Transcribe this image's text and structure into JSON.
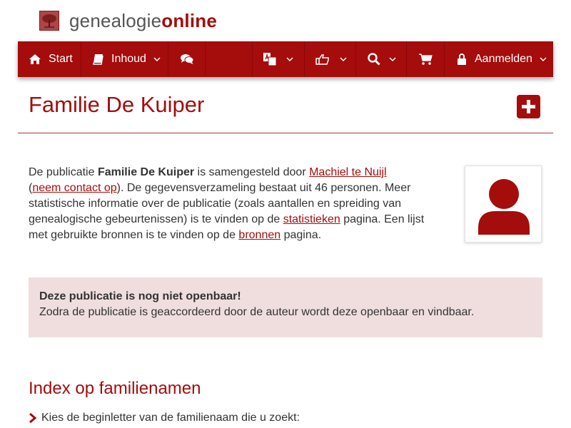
{
  "brand": {
    "part1": "genealogie",
    "part2": "online"
  },
  "nav": {
    "start": "Start",
    "inhoud": "Inhoud",
    "login": "Aanmelden"
  },
  "page": {
    "title": "Familie De Kuiper"
  },
  "intro": {
    "t1": "De publicatie ",
    "pub": "Familie De Kuiper",
    "t2": " is samengesteld door ",
    "author": "Machiel te Nuijl",
    "t3": "(",
    "contact": "neem contact op",
    "t4": "). De gegevensverzameling bestaat uit 46 personen. Meer statistische informatie over de publicatie (zoals aantallen en spreiding van genealogische gebeurtenissen) is te vinden op de ",
    "stats": "statistieken",
    "t5": " pagina. Een lijst met gebruikte bronnen is te vinden op de ",
    "sources": "bronnen",
    "t6": " pagina."
  },
  "alert": {
    "heading": "Deze publicatie is nog niet openbaar!",
    "body": "Zodra de publicatie is geaccordeerd door de auteur wordt deze openbaar en vindbaar."
  },
  "index": {
    "title": "Index op familienamen",
    "hint": "Kies de beginletter van de familienaam die u zoekt:"
  },
  "icons": [
    "tree-logo-icon",
    "home-icon",
    "book-icon",
    "comments-icon",
    "language-icon",
    "thumbs-up-icon",
    "search-icon",
    "cart-icon",
    "lock-icon",
    "chevron-down-icon",
    "plus-square-icon",
    "user-icon",
    "chevron-right-icon"
  ],
  "colors": {
    "brand": "#a50c0c",
    "text": "#333333",
    "alert_bg": "#f0dede"
  }
}
